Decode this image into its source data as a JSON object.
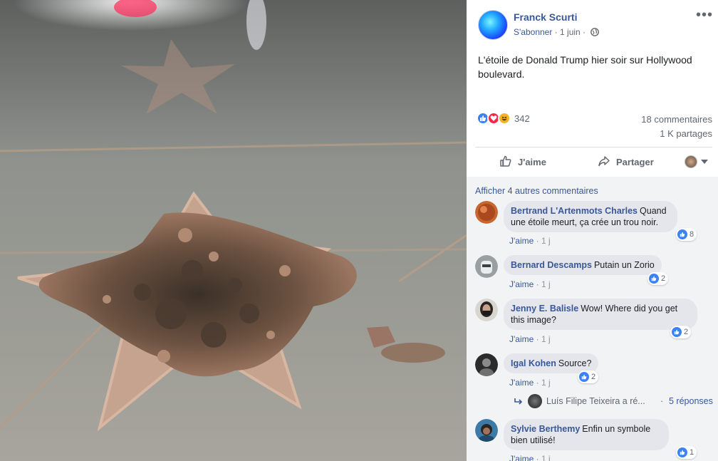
{
  "post": {
    "page_name": "Franck Scurti",
    "subscribe": "S'abonner",
    "separator": "·",
    "date": "1 juin",
    "text": "L'étoile de Donald Trump hier soir sur Hollywood boulevard.",
    "reaction_count": "342",
    "comments_count": "18 commentaires",
    "shares_count": "1 K partages",
    "more_menu_icon": "more-horizontal-icon"
  },
  "actions": {
    "like_label": "J'aime",
    "share_label": "Partager"
  },
  "comments": {
    "show_more": "Afficher 4 autres commentaires",
    "like_label": "J'aime",
    "items": [
      {
        "author": "Bertrand L'Artenmots Charles",
        "text": "Quand une étoile meurt, ça crée un trou noir.",
        "time": "1 j",
        "likes": "8"
      },
      {
        "author": "Bernard Descamps",
        "text": "Putain un Zorio",
        "time": "1 j",
        "likes": "2"
      },
      {
        "author": "Jenny E. Balisle",
        "text": "Wow! Where did you get this image?",
        "time": "1 j",
        "likes": "2"
      },
      {
        "author": "Igal Kohen",
        "text": "Source?",
        "time": "1 j",
        "likes": "2"
      },
      {
        "author": "Sylvie Berthemy",
        "text": "Enfin un symbole bien utilisé!",
        "time": "1 j",
        "likes": "1"
      }
    ],
    "reply_preview": {
      "name": "Luís Filipe Teixeira a ré...",
      "dot": "·",
      "count": "5 réponses"
    }
  },
  "colors": {
    "link": "#385898",
    "bubble": "#e4e6eb",
    "comments_bg": "#f2f3f5",
    "like_blue": "#3b82f6",
    "love_red": "#f0284a"
  }
}
